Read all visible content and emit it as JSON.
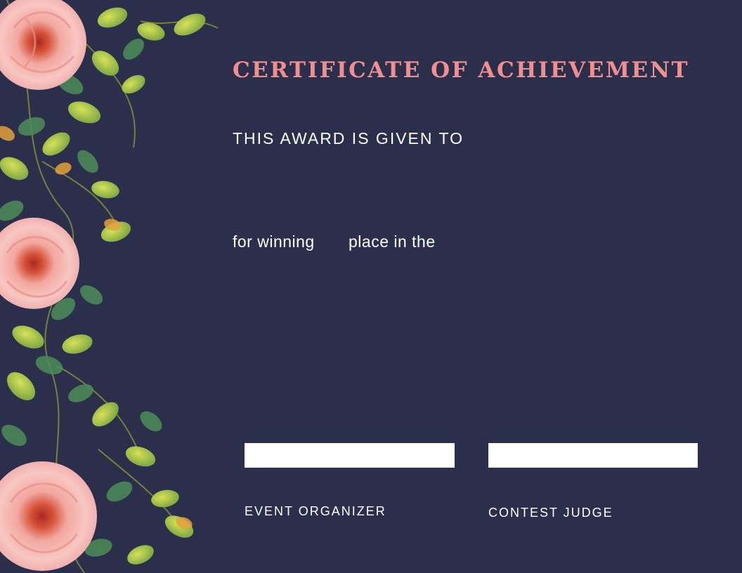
{
  "certificate": {
    "title": "CERTIFICATE OF ACHIEVEMENT",
    "given_to_text": "THIS AWARD IS GIVEN TO",
    "for_winning_text": "for winning",
    "place_text": "place in the"
  },
  "signatures": {
    "left_label": "EVENT ORGANIZER",
    "right_label": "CONTEST JUDGE"
  },
  "decoration": {
    "border_icon": "rose-floral-border-icon",
    "watermark_icon": "watermark-icon"
  },
  "colors": {
    "background": "#2b2f4b",
    "title": "#f08f92",
    "text": "#ffffff",
    "rose": "#f6b3b1",
    "rose_center": "#c4462b",
    "leaf_light": "#c8dc4a",
    "leaf_dark": "#4d8c57"
  }
}
